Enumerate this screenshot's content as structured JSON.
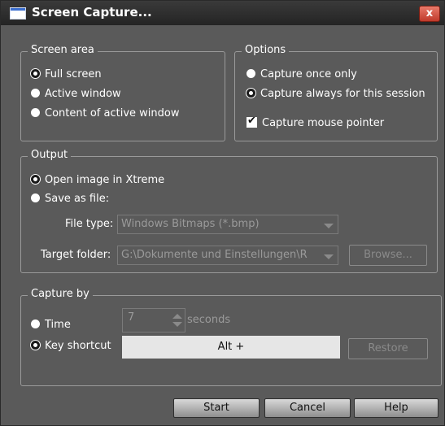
{
  "window": {
    "title": "Screen Capture...",
    "close_label": "x"
  },
  "screen_area": {
    "legend": "Screen area",
    "options": [
      "Full screen",
      "Active window",
      "Content of active window"
    ],
    "selected": "Full screen"
  },
  "options": {
    "legend": "Options",
    "radio_options": [
      "Capture once only",
      "Capture always for this session"
    ],
    "selected": "Capture always for this session",
    "checkbox_label": "Capture mouse pointer",
    "checkbox_checked": true
  },
  "output": {
    "legend": "Output",
    "radio_options": [
      "Open image in Xtreme",
      "Save as file:"
    ],
    "selected": "Open image in Xtreme",
    "file_type_label": "File type:",
    "file_type_value": "Windows Bitmaps (*.bmp)",
    "target_folder_label": "Target folder:",
    "target_folder_value": "G:\\Dokumente und Einstellungen\\R",
    "browse_label": "Browse..."
  },
  "capture_by": {
    "legend": "Capture by",
    "time_label": "Time",
    "time_value": "7",
    "time_unit": "seconds",
    "key_shortcut_label": "Key shortcut",
    "selected": "Key shortcut",
    "shortcut_value": "Alt +",
    "restore_label": "Restore"
  },
  "buttons": {
    "start": "Start",
    "cancel": "Cancel",
    "help": "Help"
  }
}
